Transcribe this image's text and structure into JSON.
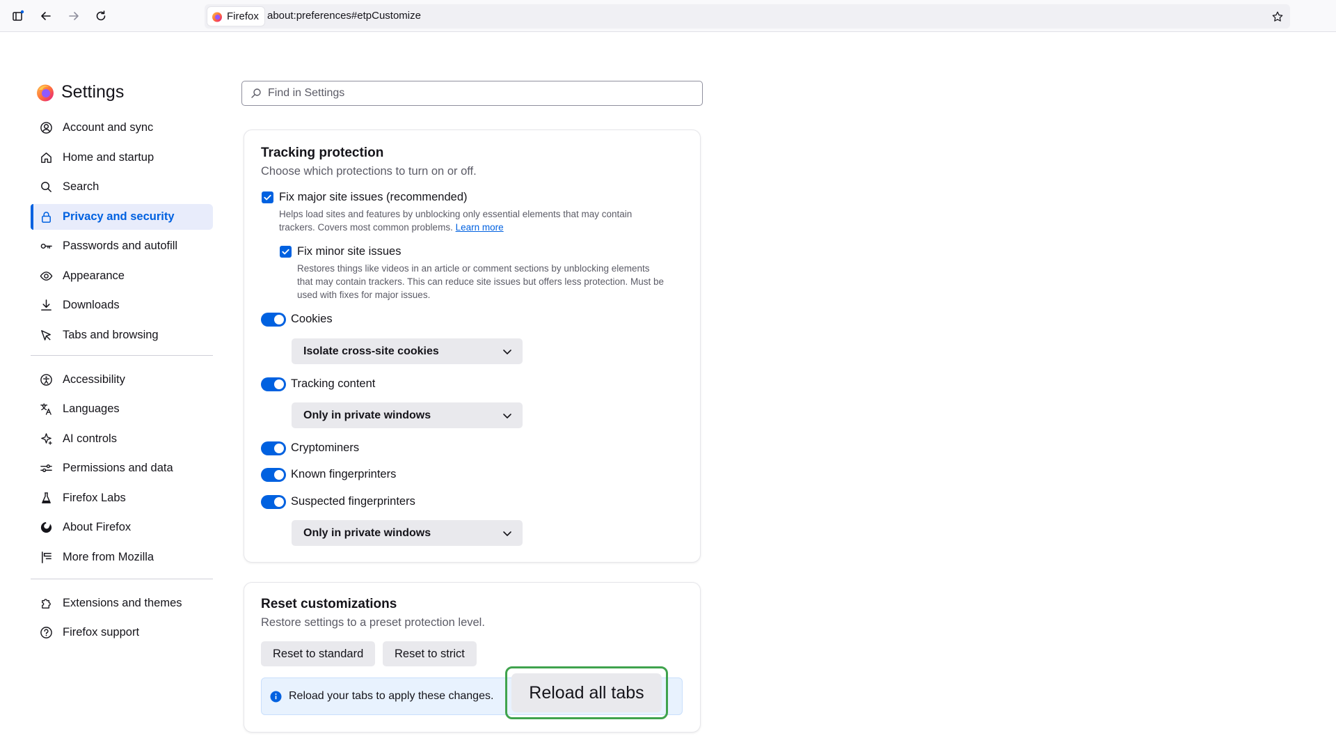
{
  "browser": {
    "identity_label": "Firefox",
    "url": "about:preferences#etpCustomize"
  },
  "sidebar": {
    "title": "Settings",
    "items": [
      {
        "label": "Account and sync",
        "icon": "account-icon"
      },
      {
        "label": "Home and startup",
        "icon": "home-icon"
      },
      {
        "label": "Search",
        "icon": "search-icon"
      },
      {
        "label": "Privacy and security",
        "icon": "lock-icon",
        "selected": true
      },
      {
        "label": "Passwords and autofill",
        "icon": "key-icon"
      },
      {
        "label": "Appearance",
        "icon": "eye-icon"
      },
      {
        "label": "Downloads",
        "icon": "download-icon"
      },
      {
        "label": "Tabs and browsing",
        "icon": "cursor-icon"
      }
    ],
    "items2": [
      {
        "label": "Accessibility",
        "icon": "accessibility-icon"
      },
      {
        "label": "Languages",
        "icon": "translate-icon"
      },
      {
        "label": "AI controls",
        "icon": "sparkle-icon"
      },
      {
        "label": "Permissions and data",
        "icon": "sliders-icon"
      },
      {
        "label": "Firefox Labs",
        "icon": "flask-icon"
      },
      {
        "label": "About Firefox",
        "icon": "firefox-icon"
      },
      {
        "label": "More from Mozilla",
        "icon": "mozilla-icon"
      }
    ],
    "items3": [
      {
        "label": "Extensions and themes",
        "icon": "puzzle-icon"
      },
      {
        "label": "Firefox support",
        "icon": "help-icon"
      }
    ]
  },
  "search": {
    "placeholder": "Find in Settings"
  },
  "tracking": {
    "title": "Tracking protection",
    "subtitle": "Choose which protections to turn on or off.",
    "fix_major": {
      "label": "Fix major site issues (recommended)",
      "desc_line1": "Helps load sites and features by unblocking only essential elements that may contain",
      "desc_line2": "trackers. Covers most common problems.",
      "link": "Learn more"
    },
    "fix_minor": {
      "label": "Fix minor site issues",
      "desc_line1": "Restores things like videos in an article or comment sections by unblocking elements",
      "desc_line2": "that may contain trackers. This can reduce site issues but offers less protection. Must be",
      "desc_line3": "used with fixes for major issues."
    },
    "cookies": {
      "label": "Cookies",
      "value": "Isolate cross-site cookies"
    },
    "tracking_content": {
      "label": "Tracking content",
      "value": "Only in private windows"
    },
    "cryptominers": {
      "label": "Cryptominers"
    },
    "known_fp": {
      "label": "Known fingerprinters"
    },
    "suspected_fp": {
      "label": "Suspected fingerprinters",
      "value": "Only in private windows"
    }
  },
  "reset": {
    "title": "Reset customizations",
    "subtitle": "Restore settings to a preset protection level.",
    "standard_label": "Reset to standard",
    "strict_label": "Reset to strict",
    "notice": "Reload your tabs to apply these changes.",
    "reload_label": "Reload all tabs"
  },
  "colors": {
    "accent": "#0061e0",
    "highlight_border": "#3fa34d",
    "selected_bg": "#e8ecfb"
  }
}
